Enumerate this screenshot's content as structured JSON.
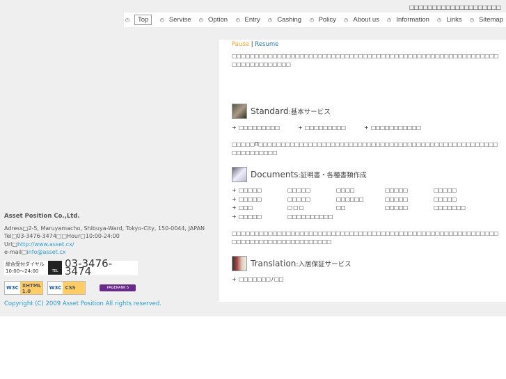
{
  "header": {
    "top_text": "□□□□□□□□□□□□□□□□□□□□"
  },
  "nav": {
    "items": [
      {
        "label": "Top",
        "active": true
      },
      {
        "label": "Servise"
      },
      {
        "label": "Option"
      },
      {
        "label": "Entry"
      },
      {
        "label": "Cashing"
      },
      {
        "label": "Policy"
      },
      {
        "label": "About us"
      },
      {
        "label": "Information"
      },
      {
        "label": "Links"
      },
      {
        "label": "Sitemap"
      }
    ]
  },
  "slideshow": {
    "pause": "Pause",
    "separator": "|",
    "resume": "Resume"
  },
  "main": {
    "intro": "□□□□□□□□□□□□□□□□□□□□□□□□□□□□□□□□□□□□□□□□□□□□□□□□□□□□□□□□□□□□□□□□□□□□□□□□",
    "standard": {
      "title": "Standard",
      "sub": ":基本サービス",
      "items": [
        "□□□□□□□□□",
        "□□□□□□□□□",
        "□□□□□□□□□□□"
      ],
      "text": "□□□□□IT□□□□□□□□□□□□□□□□□□□□□□□□□□□□□□□□□□□□□□□□□□□□□□□□□□□□□□□□□□□□□□□"
    },
    "documents": {
      "title": "Documents",
      "sub": ":証明書・各種書類作成",
      "rows": [
        [
          "□□□□□",
          "□□□□□",
          "□□□□",
          "□□□□□",
          "□□□□□"
        ],
        [
          "□□□□□",
          "□□□□□",
          "□□□□□□",
          "□□□□□",
          "□□□□□"
        ],
        [
          "□□□",
          "□ □ □",
          "□□",
          "□□□□□",
          "□□□□□□□"
        ],
        [
          "□□□□□",
          "□□□□□□□□□□"
        ]
      ],
      "text": "□□□□□□□□□□□□□□□□□□□□□□□□□□□□□□□□□□□□□□□□□□□□□□□□□□□□□□□□□□□□□□□□□□□□□□□□□□□□□□□□□"
    },
    "translation": {
      "title": "Translation",
      "sub": ":入居保証サービス",
      "items": [
        "□□□□□□□ / □□"
      ]
    }
  },
  "footer": {
    "company": "Asset Position Co.,Ltd.",
    "address": "Adress□2-5, Maruyamacho, Shibuya-Ward, Tokyo-City, 150-0044, JAPAN",
    "tel": "Tel□03-3476-3474□□Hour□10:00-24:00",
    "url_label": "Url□",
    "url": "http://www.asset.cx/",
    "email_label": "e-mail□",
    "email": "info@asset.cx",
    "dial_label": "総合受付ダイヤル",
    "dial_hours": "10:00〜24:00",
    "tel_icon": "TEL",
    "tel_number": "03-3476-3474",
    "badge_xhtml": "XHTML 1.0",
    "badge_css": "CSS",
    "badge_w3c": "W3C",
    "pagerank": "PAGERANK 5",
    "copyright": "Copyright (C) 2009 Asset Position All rights reserved."
  }
}
